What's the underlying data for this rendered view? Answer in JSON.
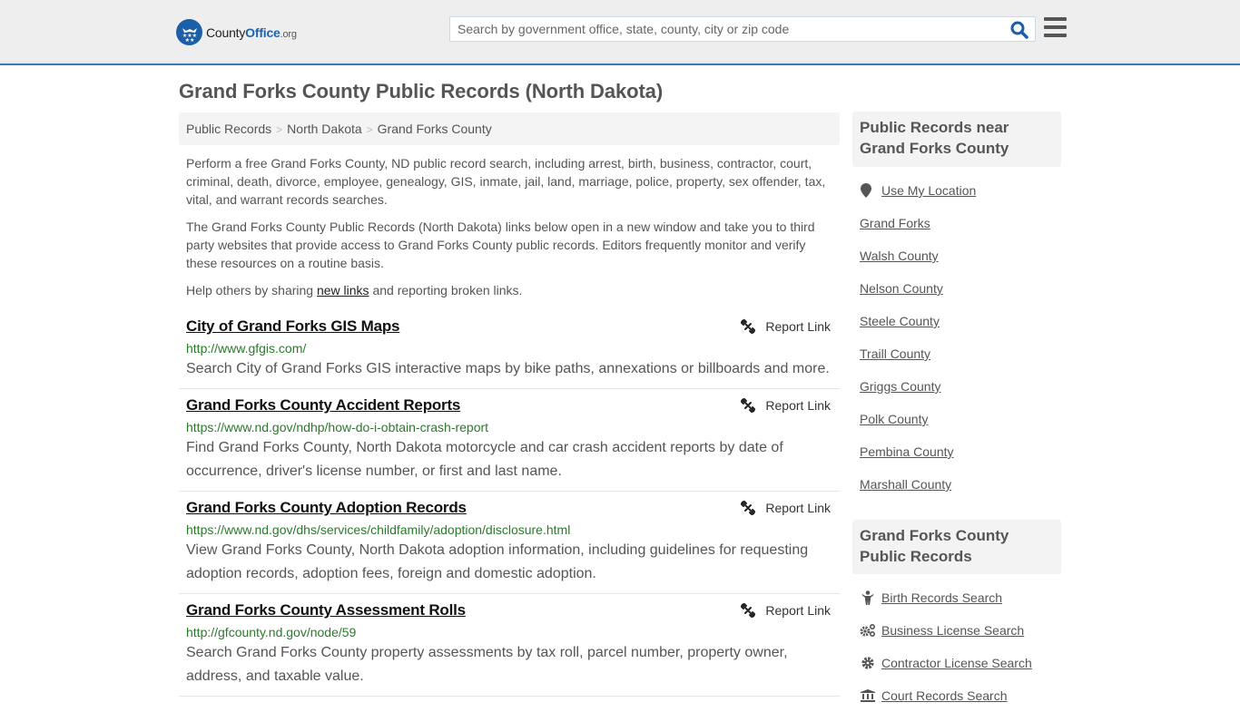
{
  "header": {
    "logo": {
      "brand_part1": "County",
      "brand_part2": "Office",
      "brand_suffix": ".org"
    },
    "search": {
      "placeholder": "Search by government office, state, county, city or zip code",
      "value": ""
    },
    "icons": {
      "search": "search-icon",
      "menu": "hamburger-menu-icon"
    }
  },
  "page": {
    "title": "Grand Forks County Public Records (North Dakota)",
    "breadcrumb": [
      {
        "label": "Public Records"
      },
      {
        "label": "North Dakota"
      },
      {
        "label": "Grand Forks County"
      }
    ],
    "intro": {
      "p1": "Perform a free Grand Forks County, ND public record search, including arrest, birth, business, contractor, court, criminal, death, divorce, employee, genealogy, GIS, inmate, jail, land, marriage, police, property, sex offender, tax, vital, and warrant records searches.",
      "p2": "The Grand Forks County Public Records (North Dakota) links below open in a new window and take you to third party websites that provide access to Grand Forks County public records. Editors frequently monitor and verify these resources on a routine basis.",
      "p3_before": "Help others by sharing ",
      "p3_link": "new links",
      "p3_after": " and reporting broken links."
    }
  },
  "records": [
    {
      "title": "City of Grand Forks GIS Maps",
      "url": "http://www.gfgis.com/",
      "description": "Search City of Grand Forks GIS interactive maps by bike paths, annexations or billboards and more.",
      "report_label": "Report Link"
    },
    {
      "title": "Grand Forks County Accident Reports",
      "url": "https://www.nd.gov/ndhp/how-do-i-obtain-crash-report",
      "description": "Find Grand Forks County, North Dakota motorcycle and car crash accident reports by date of occurrence, driver's license number, or first and last name.",
      "report_label": "Report Link"
    },
    {
      "title": "Grand Forks County Adoption Records",
      "url": "https://www.nd.gov/dhs/services/childfamily/adoption/disclosure.html",
      "description": "View Grand Forks County, North Dakota adoption information, including guidelines for requesting adoption records, adoption fees, foreign and domestic adoption.",
      "report_label": "Report Link"
    },
    {
      "title": "Grand Forks County Assessment Rolls",
      "url": "http://gfcounty.nd.gov/node/59",
      "description": "Search Grand Forks County property assessments by tax roll, parcel number, property owner, address, and taxable value.",
      "report_label": "Report Link"
    }
  ],
  "sidebar": {
    "nearby": {
      "heading": "Public Records near Grand Forks County",
      "use_location": "Use My Location",
      "items": [
        "Grand Forks",
        "Walsh County",
        "Nelson County",
        "Steele County",
        "Traill County",
        "Griggs County",
        "Polk County",
        "Pembina County",
        "Marshall County"
      ]
    },
    "county_records": {
      "heading": "Grand Forks County Public Records",
      "items": [
        {
          "label": "Birth Records Search",
          "icon": "child-icon"
        },
        {
          "label": "Business License Search",
          "icon": "cogs-icon"
        },
        {
          "label": "Contractor License Search",
          "icon": "gear-icon"
        },
        {
          "label": "Court Records Search",
          "icon": "courthouse-icon"
        }
      ]
    }
  },
  "colors": {
    "brand_blue": "#1b63b0",
    "header_border": "#3a7aae",
    "url_green": "#2b7a2b",
    "text_gray": "#555555"
  }
}
